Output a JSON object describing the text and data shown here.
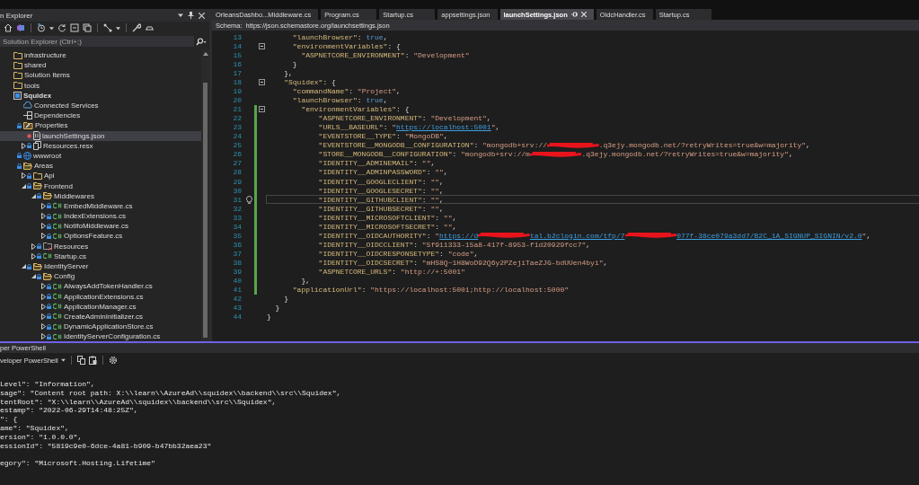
{
  "explorer": {
    "title": "n Explorer",
    "search": {
      "placeholder": "Solution Explorer (Ctrl+;)"
    },
    "tree": [
      {
        "label": "infrastructure",
        "kind": "folder",
        "locked": false,
        "modified": false,
        "selected": false
      },
      {
        "label": "shared",
        "kind": "folder",
        "locked": false,
        "modified": false,
        "selected": false
      },
      {
        "label": "Solution Items",
        "kind": "folder",
        "locked": false,
        "modified": false,
        "selected": false
      },
      {
        "label": "tools",
        "kind": "folder",
        "locked": false,
        "modified": false,
        "selected": false
      },
      {
        "label": "Squidex",
        "kind": "project",
        "locked": false,
        "modified": false,
        "selected": false,
        "children": [
          {
            "label": "Connected Services",
            "kind": "cloud",
            "locked": false,
            "modified": false,
            "selected": false
          },
          {
            "label": "Dependencies",
            "kind": "deps",
            "locked": false,
            "modified": false,
            "selected": false
          },
          {
            "label": "Properties",
            "kind": "props",
            "locked": true,
            "modified": false,
            "selected": false,
            "children": [
              {
                "label": "launchSettings.json",
                "kind": "json",
                "locked": false,
                "modified": true,
                "selected": true
              },
              {
                "label": "Resources.resx",
                "kind": "resx",
                "locked": true,
                "modified": false,
                "expanded": false,
                "selected": false
              }
            ]
          },
          {
            "label": "wwwroot",
            "kind": "globe",
            "locked": true,
            "modified": false,
            "selected": false
          },
          {
            "label": "Areas",
            "kind": "folder-open",
            "locked": true,
            "modified": false,
            "selected": false,
            "children": [
              {
                "label": "Api",
                "kind": "folder",
                "locked": true,
                "modified": false,
                "expanded": false,
                "selected": false
              },
              {
                "label": "Frontend",
                "kind": "folder-open",
                "locked": true,
                "modified": false,
                "expanded": true,
                "selected": false,
                "children": [
                  {
                    "label": "Middlewares",
                    "kind": "folder-open",
                    "locked": true,
                    "modified": false,
                    "expanded": true,
                    "selected": false,
                    "children": [
                      {
                        "label": "EmbedMiddleware.cs",
                        "kind": "cs",
                        "locked": true,
                        "modified": false,
                        "expanded": false,
                        "selected": false
                      },
                      {
                        "label": "IndexExtensions.cs",
                        "kind": "cs",
                        "locked": true,
                        "modified": false,
                        "expanded": false,
                        "selected": false
                      },
                      {
                        "label": "NotifoMiddleware.cs",
                        "kind": "cs",
                        "locked": true,
                        "modified": false,
                        "expanded": false,
                        "selected": false
                      },
                      {
                        "label": "OptionsFeature.cs",
                        "kind": "cs",
                        "locked": true,
                        "modified": false,
                        "expanded": false,
                        "selected": false
                      }
                    ]
                  },
                  {
                    "label": "Resources",
                    "kind": "res-folder",
                    "locked": true,
                    "modified": false,
                    "expanded": false,
                    "selected": false
                  },
                  {
                    "label": "Startup.cs",
                    "kind": "cs",
                    "locked": true,
                    "modified": false,
                    "expanded": false,
                    "selected": false
                  }
                ]
              },
              {
                "label": "IdentityServer",
                "kind": "folder-open",
                "locked": true,
                "modified": false,
                "expanded": true,
                "selected": false,
                "children": [
                  {
                    "label": "Config",
                    "kind": "folder-open",
                    "locked": true,
                    "modified": false,
                    "expanded": true,
                    "selected": false,
                    "children": [
                      {
                        "label": "AlwaysAddTokenHandler.cs",
                        "kind": "cs",
                        "locked": true,
                        "modified": false,
                        "expanded": false,
                        "selected": false
                      },
                      {
                        "label": "ApplicationExtensions.cs",
                        "kind": "cs",
                        "locked": true,
                        "modified": false,
                        "expanded": false,
                        "selected": false
                      },
                      {
                        "label": "ApplicationManager.cs",
                        "kind": "cs",
                        "locked": true,
                        "modified": false,
                        "expanded": false,
                        "selected": false
                      },
                      {
                        "label": "CreateAdminInitializer.cs",
                        "kind": "cs",
                        "locked": true,
                        "modified": false,
                        "expanded": false,
                        "selected": false
                      },
                      {
                        "label": "DynamicApplicationStore.cs",
                        "kind": "cs",
                        "locked": true,
                        "modified": false,
                        "expanded": false,
                        "selected": false
                      },
                      {
                        "label": "IdentityServerConfiguration.cs",
                        "kind": "cs",
                        "locked": true,
                        "modified": false,
                        "expanded": false,
                        "selected": false
                      }
                    ]
                  }
                ]
              }
            ]
          }
        ]
      }
    ]
  },
  "editor": {
    "tabs": [
      {
        "label": "OrleansDashbo...Middleware.cs",
        "selected": false
      },
      {
        "label": "Program.cs",
        "selected": false
      },
      {
        "label": "Startup.cs",
        "selected": false
      },
      {
        "label": "appsettings.json",
        "selected": false
      },
      {
        "label": "launchSettings.json",
        "selected": true
      },
      {
        "label": "OidcHandler.cs",
        "selected": false
      },
      {
        "label": "Startup.cs",
        "selected": false
      }
    ],
    "schema": {
      "label": "Schema:",
      "url": "https://json.schemastore.org/launchsettings.json"
    },
    "lines": [
      {
        "number": "13",
        "changed": false,
        "collapsible": false,
        "current": false,
        "tokens": [
          {
            "kind": "key",
            "text": "      \"launchBrowser\""
          },
          {
            "kind": "punct",
            "text": ": "
          },
          {
            "kind": "kw",
            "text": "true"
          },
          {
            "kind": "punct",
            "text": ","
          }
        ]
      },
      {
        "number": "14",
        "changed": false,
        "collapsible": true,
        "current": false,
        "tokens": [
          {
            "kind": "key",
            "text": "      \"environmentVariables\""
          },
          {
            "kind": "punct",
            "text": ": {"
          }
        ]
      },
      {
        "number": "15",
        "changed": false,
        "collapsible": false,
        "current": false,
        "tokens": [
          {
            "kind": "key",
            "text": "        \"ASPNETCORE_ENVIRONMENT\""
          },
          {
            "kind": "punct",
            "text": ": "
          },
          {
            "kind": "str",
            "text": "\"Development\""
          }
        ]
      },
      {
        "number": "16",
        "changed": false,
        "collapsible": false,
        "current": false,
        "tokens": [
          {
            "kind": "punct",
            "text": "      }"
          }
        ]
      },
      {
        "number": "17",
        "changed": false,
        "collapsible": false,
        "current": false,
        "tokens": [
          {
            "kind": "punct",
            "text": "    },"
          }
        ]
      },
      {
        "number": "18",
        "changed": false,
        "collapsible": true,
        "current": false,
        "tokens": [
          {
            "kind": "key",
            "text": "    \"Squidex\""
          },
          {
            "kind": "punct",
            "text": ": {"
          }
        ]
      },
      {
        "number": "19",
        "changed": false,
        "collapsible": false,
        "current": false,
        "tokens": [
          {
            "kind": "key",
            "text": "      \"commandName\""
          },
          {
            "kind": "punct",
            "text": ": "
          },
          {
            "kind": "str",
            "text": "\"Project\""
          },
          {
            "kind": "punct",
            "text": ","
          }
        ]
      },
      {
        "number": "20",
        "changed": false,
        "collapsible": false,
        "current": false,
        "tokens": [
          {
            "kind": "key",
            "text": "      \"launchBrowser\""
          },
          {
            "kind": "punct",
            "text": ": "
          },
          {
            "kind": "kw",
            "text": "true"
          },
          {
            "kind": "punct",
            "text": ","
          }
        ]
      },
      {
        "number": "21",
        "changed": true,
        "collapsible": true,
        "current": false,
        "tokens": [
          {
            "kind": "key",
            "text": "        \"environmentVariables\""
          },
          {
            "kind": "punct",
            "text": ": {"
          }
        ]
      },
      {
        "number": "22",
        "changed": true,
        "collapsible": false,
        "current": false,
        "tokens": [
          {
            "kind": "key",
            "text": "            \"ASPNETCORE_ENVIRONMENT\""
          },
          {
            "kind": "punct",
            "text": ": "
          },
          {
            "kind": "str",
            "text": "\"Development\""
          },
          {
            "kind": "punct",
            "text": ","
          }
        ]
      },
      {
        "number": "23",
        "changed": true,
        "collapsible": false,
        "current": false,
        "tokens": [
          {
            "kind": "key",
            "text": "            \"URLS__BASEURL\""
          },
          {
            "kind": "punct",
            "text": ": "
          },
          {
            "kind": "str",
            "text": "\""
          },
          {
            "kind": "link",
            "text": "https://localhost:5001"
          },
          {
            "kind": "str",
            "text": "\""
          },
          {
            "kind": "punct",
            "text": ","
          }
        ]
      },
      {
        "number": "24",
        "changed": true,
        "collapsible": false,
        "current": false,
        "tokens": [
          {
            "kind": "key",
            "text": "            \"EVENTSTORE__TYPE\""
          },
          {
            "kind": "punct",
            "text": ": "
          },
          {
            "kind": "str",
            "text": "\"MongoDB\""
          },
          {
            "kind": "punct",
            "text": ","
          }
        ]
      },
      {
        "number": "25",
        "changed": true,
        "collapsible": false,
        "current": false,
        "tokens": [
          {
            "kind": "key",
            "text": "            \"EVENTSTORE__MONGODB__CONFIGURATION\""
          },
          {
            "kind": "punct",
            "text": ": "
          },
          {
            "kind": "str",
            "text": "\"mongodb+srv://"
          },
          {
            "kind": "redact"
          },
          {
            "kind": "str",
            "text": ".q3ejy.mongodb.net/?retryWrites=true&w=majority\""
          },
          {
            "kind": "punct",
            "text": ","
          }
        ]
      },
      {
        "number": "26",
        "changed": true,
        "collapsible": false,
        "current": false,
        "tokens": [
          {
            "kind": "key",
            "text": "            \"STORE__MONGODB__CONFIGURATION\""
          },
          {
            "kind": "punct",
            "text": ": "
          },
          {
            "kind": "str",
            "text": "\"mongodb+srv://m"
          },
          {
            "kind": "redact"
          },
          {
            "kind": "str",
            "text": ".q3ejy.mongodb.net/?retryWrites=true&w=majority\""
          },
          {
            "kind": "punct",
            "text": ","
          }
        ]
      },
      {
        "number": "27",
        "changed": true,
        "collapsible": false,
        "current": false,
        "tokens": [
          {
            "kind": "key",
            "text": "            \"IDENTITY__ADMINEMAIL\""
          },
          {
            "kind": "punct",
            "text": ": "
          },
          {
            "kind": "str",
            "text": "\"\""
          },
          {
            "kind": "punct",
            "text": ","
          }
        ]
      },
      {
        "number": "28",
        "changed": true,
        "collapsible": false,
        "current": false,
        "tokens": [
          {
            "kind": "key",
            "text": "            \"IDENTITY__ADMINPASSWORD\""
          },
          {
            "kind": "punct",
            "text": ": "
          },
          {
            "kind": "str",
            "text": "\"\""
          },
          {
            "kind": "punct",
            "text": ","
          }
        ]
      },
      {
        "number": "29",
        "changed": true,
        "collapsible": false,
        "current": false,
        "tokens": [
          {
            "kind": "key",
            "text": "            \"IDENTITY__GOOGLECLIENT\""
          },
          {
            "kind": "punct",
            "text": ": "
          },
          {
            "kind": "str",
            "text": "\"\""
          },
          {
            "kind": "punct",
            "text": ","
          }
        ]
      },
      {
        "number": "30",
        "changed": true,
        "collapsible": false,
        "current": false,
        "tokens": [
          {
            "kind": "key",
            "text": "            \"IDENTITY__GOOGLESECRET\""
          },
          {
            "kind": "punct",
            "text": ": "
          },
          {
            "kind": "str",
            "text": "\"\""
          },
          {
            "kind": "punct",
            "text": ","
          }
        ]
      },
      {
        "number": "31",
        "changed": true,
        "collapsible": false,
        "current": true,
        "tokens": [
          {
            "kind": "key",
            "text": "            \"IDENTITY__GITHUBCLIENT\""
          },
          {
            "kind": "punct",
            "text": ": "
          },
          {
            "kind": "str",
            "text": "\"\""
          },
          {
            "kind": "punct",
            "text": ","
          }
        ]
      },
      {
        "number": "32",
        "changed": true,
        "collapsible": false,
        "current": false,
        "tokens": [
          {
            "kind": "key",
            "text": "            \"IDENTITY__GITHUBSECRET\""
          },
          {
            "kind": "punct",
            "text": ": "
          },
          {
            "kind": "str",
            "text": "\"\""
          },
          {
            "kind": "punct",
            "text": ","
          }
        ]
      },
      {
        "number": "33",
        "changed": true,
        "collapsible": false,
        "current": false,
        "tokens": [
          {
            "kind": "key",
            "text": "            \"IDENTITY__MICROSOFTCLIENT\""
          },
          {
            "kind": "punct",
            "text": ": "
          },
          {
            "kind": "str",
            "text": "\"\""
          },
          {
            "kind": "punct",
            "text": ","
          }
        ]
      },
      {
        "number": "34",
        "changed": true,
        "collapsible": false,
        "current": false,
        "tokens": [
          {
            "kind": "key",
            "text": "            \"IDENTITY__MICROSOFTSECRET\""
          },
          {
            "kind": "punct",
            "text": ": "
          },
          {
            "kind": "str",
            "text": "\"\""
          },
          {
            "kind": "punct",
            "text": ","
          }
        ]
      },
      {
        "number": "35",
        "changed": true,
        "collapsible": false,
        "current": false,
        "tokens": [
          {
            "kind": "key",
            "text": "            \"IDENTITY__OIDCAUTHORITY\""
          },
          {
            "kind": "punct",
            "text": ": "
          },
          {
            "kind": "str",
            "text": "\""
          },
          {
            "kind": "link",
            "text": "https://d"
          },
          {
            "kind": "redact"
          },
          {
            "kind": "link",
            "text": "tal.b2clogin.com/tfp/7"
          },
          {
            "kind": "redact"
          },
          {
            "kind": "link",
            "text": "077f-38ce079a3dd7/B2C_1A_SIGNUP_SIGNIN/v2.0"
          },
          {
            "kind": "str",
            "text": "\""
          },
          {
            "kind": "punct",
            "text": ","
          }
        ]
      },
      {
        "number": "36",
        "changed": true,
        "collapsible": false,
        "current": false,
        "tokens": [
          {
            "kind": "key",
            "text": "            \"IDENTITY__OIDCCLIENT\""
          },
          {
            "kind": "punct",
            "text": ": "
          },
          {
            "kind": "str",
            "text": "\"5f911333-15a8-417f-8953-f1d20929fcc7\""
          },
          {
            "kind": "punct",
            "text": ","
          }
        ]
      },
      {
        "number": "37",
        "changed": true,
        "collapsible": false,
        "current": false,
        "tokens": [
          {
            "kind": "key",
            "text": "            \"IDENTITY__OIDCRESPONSETYPE\""
          },
          {
            "kind": "punct",
            "text": ": "
          },
          {
            "kind": "str",
            "text": "\"code\""
          },
          {
            "kind": "punct",
            "text": ","
          }
        ]
      },
      {
        "number": "38",
        "changed": true,
        "collapsible": false,
        "current": false,
        "tokens": [
          {
            "kind": "key",
            "text": "            \"IDENTITY__OIDCSECRET\""
          },
          {
            "kind": "punct",
            "text": ": "
          },
          {
            "kind": "str",
            "text": "\"mHS8Q~1H8WoD92Q6y2PZejiTaeZJG-bdUUen4byi\""
          },
          {
            "kind": "punct",
            "text": ","
          }
        ]
      },
      {
        "number": "39",
        "changed": true,
        "collapsible": false,
        "current": false,
        "tokens": [
          {
            "kind": "key",
            "text": "            \"ASPNETCORE_URLS\""
          },
          {
            "kind": "punct",
            "text": ": "
          },
          {
            "kind": "str",
            "text": "\"http://+:5001\""
          }
        ]
      },
      {
        "number": "40",
        "changed": true,
        "collapsible": false,
        "current": false,
        "tokens": [
          {
            "kind": "punct",
            "text": "        },"
          }
        ]
      },
      {
        "number": "41",
        "changed": true,
        "collapsible": false,
        "current": false,
        "tokens": [
          {
            "kind": "key",
            "text": "      \"applicationUrl\""
          },
          {
            "kind": "punct",
            "text": ": "
          },
          {
            "kind": "str",
            "text": "\"https://localhost:5001;http://localhost:5000\""
          }
        ]
      },
      {
        "number": "42",
        "changed": false,
        "collapsible": false,
        "current": false,
        "tokens": [
          {
            "kind": "punct",
            "text": "    }"
          }
        ]
      },
      {
        "number": "43",
        "changed": false,
        "collapsible": false,
        "current": false,
        "tokens": [
          {
            "kind": "punct",
            "text": "  }"
          }
        ]
      },
      {
        "number": "44",
        "changed": false,
        "collapsible": false,
        "current": false,
        "tokens": [
          {
            "kind": "punct",
            "text": "}"
          }
        ]
      }
    ]
  },
  "terminal": {
    "title": "per PowerShell",
    "profile": "veloper PowerShell",
    "lines": [
      {
        "kind": "output",
        "text": "Level\": \"Information\","
      },
      {
        "kind": "output",
        "text": "sage\": \"Content root path: X:\\\\learn\\\\AzureAd\\\\squidex\\\\backend\\\\src\\\\Squidex\","
      },
      {
        "kind": "output",
        "text": "tentRoot\": \"X:\\\\learn\\\\AzureAd\\\\squidex\\\\backend\\\\src\\\\Squidex\","
      },
      {
        "kind": "output",
        "text": "estamp\": \"2022-06-29T14:48:25Z\","
      },
      {
        "kind": "output",
        "text": "\": {"
      },
      {
        "kind": "output",
        "text": "ame\": \"Squidex\","
      },
      {
        "kind": "output",
        "text": "ersion\": \"1.0.0.0\","
      },
      {
        "kind": "output",
        "text": "essionId\": \"5819c9e0-6dce-4a81-b909-b47bb32aea23\""
      },
      {
        "kind": "blank"
      },
      {
        "kind": "output",
        "text": "egory\": \"Microsoft.Hosting.Lifetime\""
      }
    ]
  }
}
